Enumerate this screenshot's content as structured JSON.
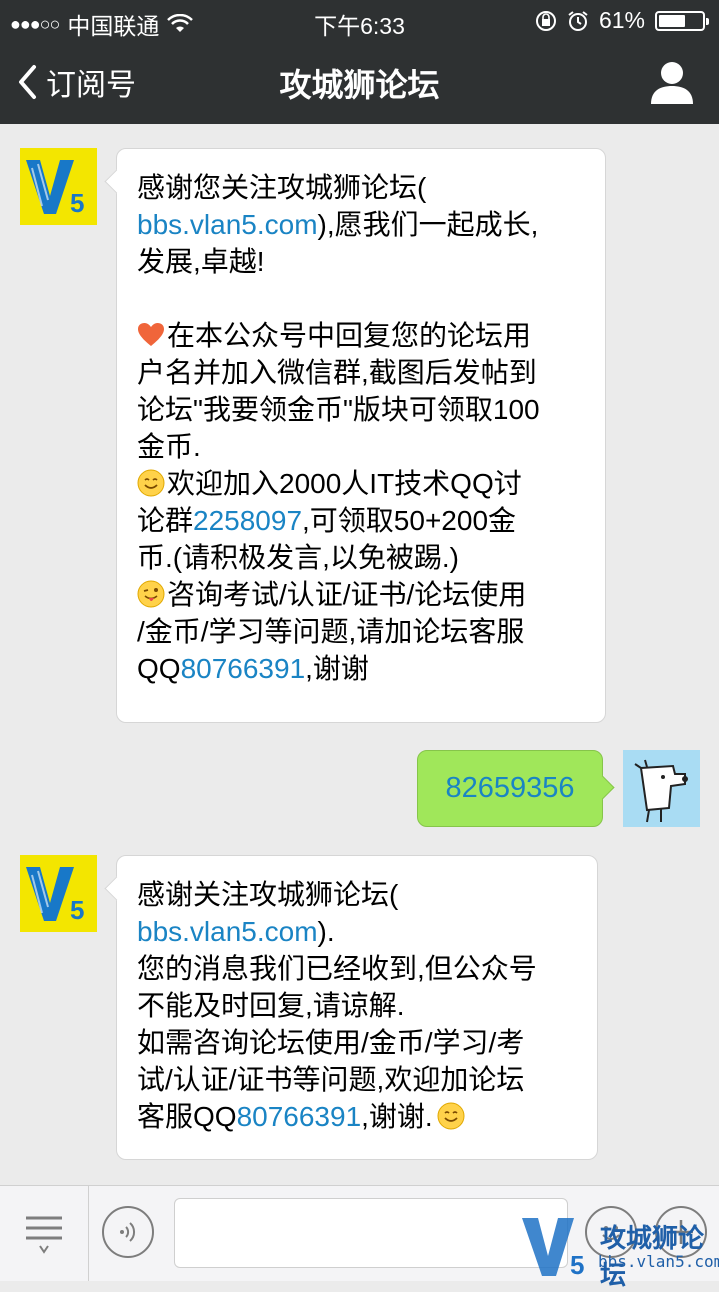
{
  "status_bar": {
    "signal": "●●●○○",
    "carrier": "中国联通",
    "time": "下午6:33",
    "battery_percent": "61%",
    "battery_level": 0.61
  },
  "nav": {
    "back_label": "订阅号",
    "title": "攻城狮论坛"
  },
  "messages": [
    {
      "lines": [
        "感谢您关注攻城狮论坛(",
        "bbs.vlan5.com",
        "),愿我们一起成长,",
        "发展,卓越!",
        "在本公众号中回复您的论坛用",
        "户名并加入微信群,截图后发帖到",
        "论坛\"我要领金币\"版块可领取100",
        "金币.",
        "欢迎加入2000人IT技术QQ讨",
        "论群",
        "2258097",
        ",可领取50+200金",
        "币.(请积极发言,以免被踢.)",
        "咨询考试/认证/证书/论坛使用",
        "/金币/学习等问题,请加论坛客服",
        "QQ",
        "80766391",
        ",谢谢"
      ]
    },
    {
      "text": "82659356"
    },
    {
      "lines": [
        "感谢关注攻城狮论坛(",
        "bbs.vlan5.com",
        ").",
        "您的消息我们已经收到,但公众号",
        "不能及时回复,请谅解.",
        "如需咨询论坛使用/金币/学习/考",
        "试/认证/证书等问题,欢迎加论坛",
        "客服QQ",
        "80766391",
        ",谢谢."
      ]
    }
  ],
  "watermark": {
    "title": "攻城狮论坛",
    "url": "bbs.vlan5.com"
  },
  "icons": {
    "back": "chevron-left-icon",
    "user": "person-icon",
    "heart": "heart-emoji-icon",
    "smile": "smile-emoji-icon",
    "wink": "wink-tongue-emoji-icon",
    "menu": "menu-list-icon",
    "voice": "voice-icon",
    "emoji": "emoji-icon",
    "plus": "plus-icon"
  },
  "colors": {
    "nav_bg": "#2e3132",
    "link": "#1a84c4",
    "bubble_out": "#a0e75a",
    "chat_bg": "#ebebeb"
  }
}
